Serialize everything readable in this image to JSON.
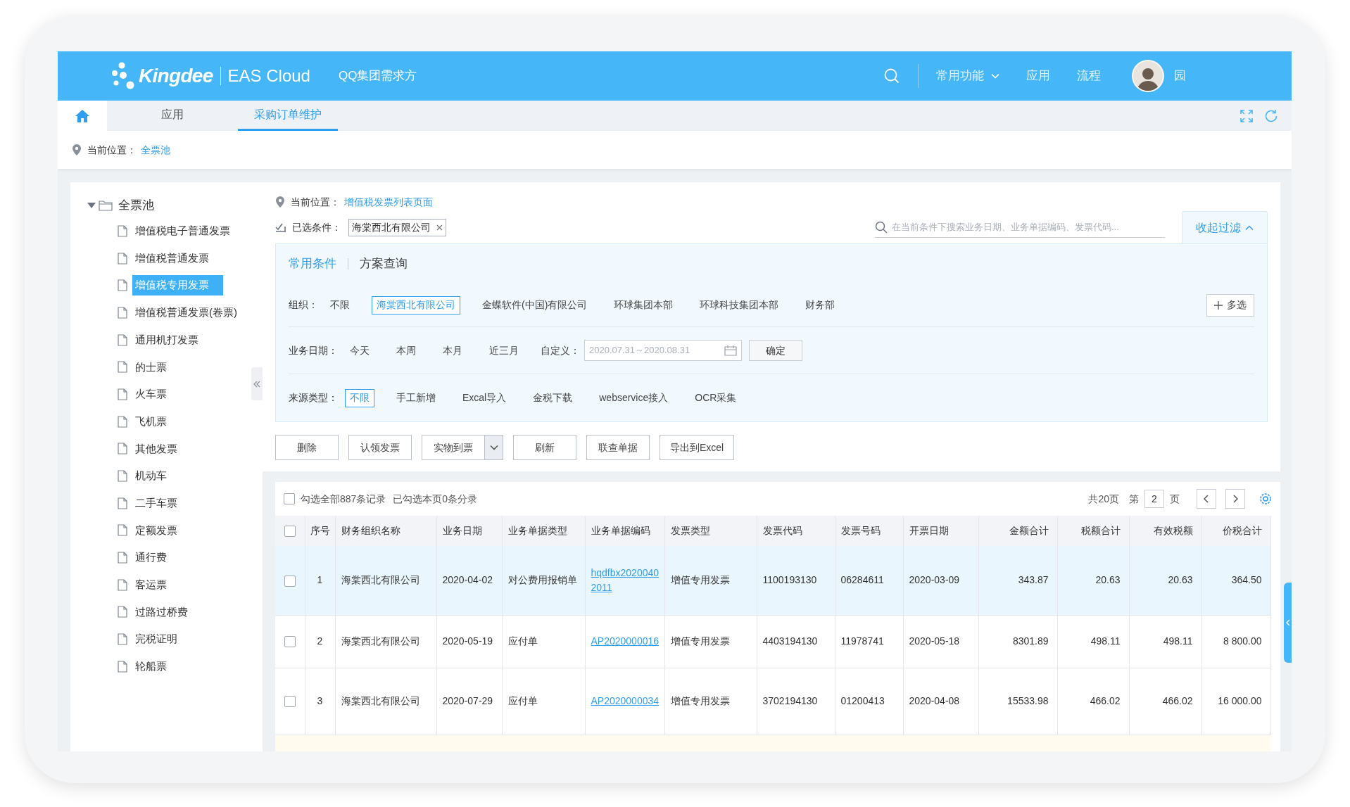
{
  "header": {
    "logo": "Kingdee",
    "product": "EAS Cloud",
    "tenant": "QQ集团需求方",
    "nav": [
      {
        "label": "常用功能",
        "kind": "dropdown"
      },
      {
        "label": "应用",
        "kind": "link"
      },
      {
        "label": "流程",
        "kind": "link"
      }
    ],
    "user": "园"
  },
  "tabs": [
    {
      "label": "应用",
      "selected": false
    },
    {
      "label": "采购订单维护",
      "selected": true
    }
  ],
  "breadcrumb": {
    "label": "当前位置：",
    "value": "全票池"
  },
  "sidebar": {
    "root": {
      "label": "全票池",
      "expanded": true,
      "children": [
        {
          "label": "增值税电子普通发票",
          "selected": false
        },
        {
          "label": "增值税普通发票",
          "selected": false
        },
        {
          "label": "增值税专用发票",
          "selected": true
        },
        {
          "label": "增值税普通发票(卷票)",
          "selected": false
        },
        {
          "label": "通用机打发票",
          "selected": false
        },
        {
          "label": "的士票",
          "selected": false
        },
        {
          "label": "火车票",
          "selected": false
        },
        {
          "label": "飞机票",
          "selected": false
        },
        {
          "label": "其他发票",
          "selected": false
        },
        {
          "label": "机动车",
          "selected": false
        },
        {
          "label": "二手车票",
          "selected": false
        },
        {
          "label": "定额发票",
          "selected": false
        },
        {
          "label": "通行费",
          "selected": false
        },
        {
          "label": "客运票",
          "selected": false
        },
        {
          "label": "过路过桥费",
          "selected": false
        },
        {
          "label": "完税证明",
          "selected": false
        },
        {
          "label": "轮船票",
          "selected": false
        }
      ]
    }
  },
  "filter": {
    "location_label": "当前位置：",
    "location": "增值税发票列表页面",
    "chosen_label": "已选条件：",
    "chips": [
      "海棠西北有限公司"
    ],
    "search": {
      "placeholder": "在当前条件下搜索业务日期、业务单据编码、发票代码..."
    },
    "toggle": "收起过滤",
    "tabs": [
      {
        "label": "常用条件",
        "selected": true
      },
      {
        "label": "方案查询",
        "selected": false
      }
    ],
    "rows": [
      {
        "label": "组织：",
        "kind": "options",
        "options": [
          {
            "label": "不限",
            "selected": false
          },
          {
            "label": "海棠西北有限公司",
            "selected": true
          },
          {
            "label": "金蝶软件(中国)有限公司",
            "selected": false
          },
          {
            "label": "环球集团本部",
            "selected": false
          },
          {
            "label": "环球科技集团本部",
            "selected": false
          },
          {
            "label": "财务部",
            "selected": false
          }
        ],
        "multi": "多选"
      },
      {
        "label": "业务日期：",
        "kind": "dates",
        "options": [
          {
            "label": "今天",
            "selected": false
          },
          {
            "label": "本周",
            "selected": false
          },
          {
            "label": "本月",
            "selected": false
          },
          {
            "label": "近三月",
            "selected": false
          }
        ],
        "custom_label": "自定义：",
        "range": {
          "placeholder": "2020.07.31～2020.08.31"
        },
        "confirm": "确定"
      },
      {
        "label": "来源类型：",
        "kind": "options",
        "options": [
          {
            "label": "不限",
            "selected": true
          },
          {
            "label": "手工新增",
            "selected": false
          },
          {
            "label": "Excal导入",
            "selected": false
          },
          {
            "label": "金税下载",
            "selected": false
          },
          {
            "label": "webservice接入",
            "selected": false
          },
          {
            "label": "OCR采集",
            "selected": false
          }
        ]
      }
    ]
  },
  "actions": [
    {
      "label": "删除",
      "kind": "button"
    },
    {
      "label": "认领发票",
      "kind": "button"
    },
    {
      "label": "实物到票",
      "kind": "split"
    },
    {
      "label": "刷新",
      "kind": "button"
    },
    {
      "label": "联查单据",
      "kind": "button"
    },
    {
      "label": "导出到Excel",
      "kind": "button"
    }
  ],
  "table": {
    "select_all": {
      "label": "勾选全部887条记录",
      "checked": false
    },
    "selected_info": "已勾选本页0条分录",
    "pages": "共20页",
    "page_prefix": "第",
    "page": "2",
    "page_suffix": "页",
    "header_checked": false,
    "columns": [
      {
        "label": "序号",
        "kind": "text"
      },
      {
        "label": "财务组织名称",
        "kind": "text"
      },
      {
        "label": "业务日期",
        "kind": "text"
      },
      {
        "label": "业务单据类型",
        "kind": "text"
      },
      {
        "label": "业务单据编码",
        "kind": "link"
      },
      {
        "label": "发票类型",
        "kind": "text"
      },
      {
        "label": "发票代码",
        "kind": "text"
      },
      {
        "label": "发票号码",
        "kind": "text"
      },
      {
        "label": "开票日期",
        "kind": "text"
      },
      {
        "label": "金额合计",
        "kind": "text"
      },
      {
        "label": "税额合计",
        "kind": "text"
      },
      {
        "label": "有效税额",
        "kind": "text"
      },
      {
        "label": "价税合计",
        "kind": "text"
      }
    ],
    "rows": [
      {
        "selected": true,
        "checked": false,
        "cells": [
          "1",
          "海棠西北有限公司",
          "2020-04-02",
          "对公费用报销单",
          "hqdfbx20200402011",
          "增值专用发票",
          "1100193130",
          "06284611",
          "2020-03-09",
          "343.87",
          "20.63",
          "20.63",
          "364.50"
        ]
      },
      {
        "selected": false,
        "checked": false,
        "cells": [
          "2",
          "海棠西北有限公司",
          "2020-05-19",
          "应付单",
          "AP2020000016",
          "增值专用发票",
          "4403194130",
          "11978741",
          "2020-05-18",
          "8301.89",
          "498.11",
          "498.11",
          "8 800.00"
        ]
      },
      {
        "selected": false,
        "checked": false,
        "cells": [
          "3",
          "海棠西北有限公司",
          "2020-07-29",
          "应付单",
          "AP2020000034",
          "增值专用发票",
          "3702194130",
          "01200413",
          "2020-04-08",
          "15533.98",
          "466.02",
          "466.02",
          "16 000.00"
        ]
      }
    ]
  }
}
